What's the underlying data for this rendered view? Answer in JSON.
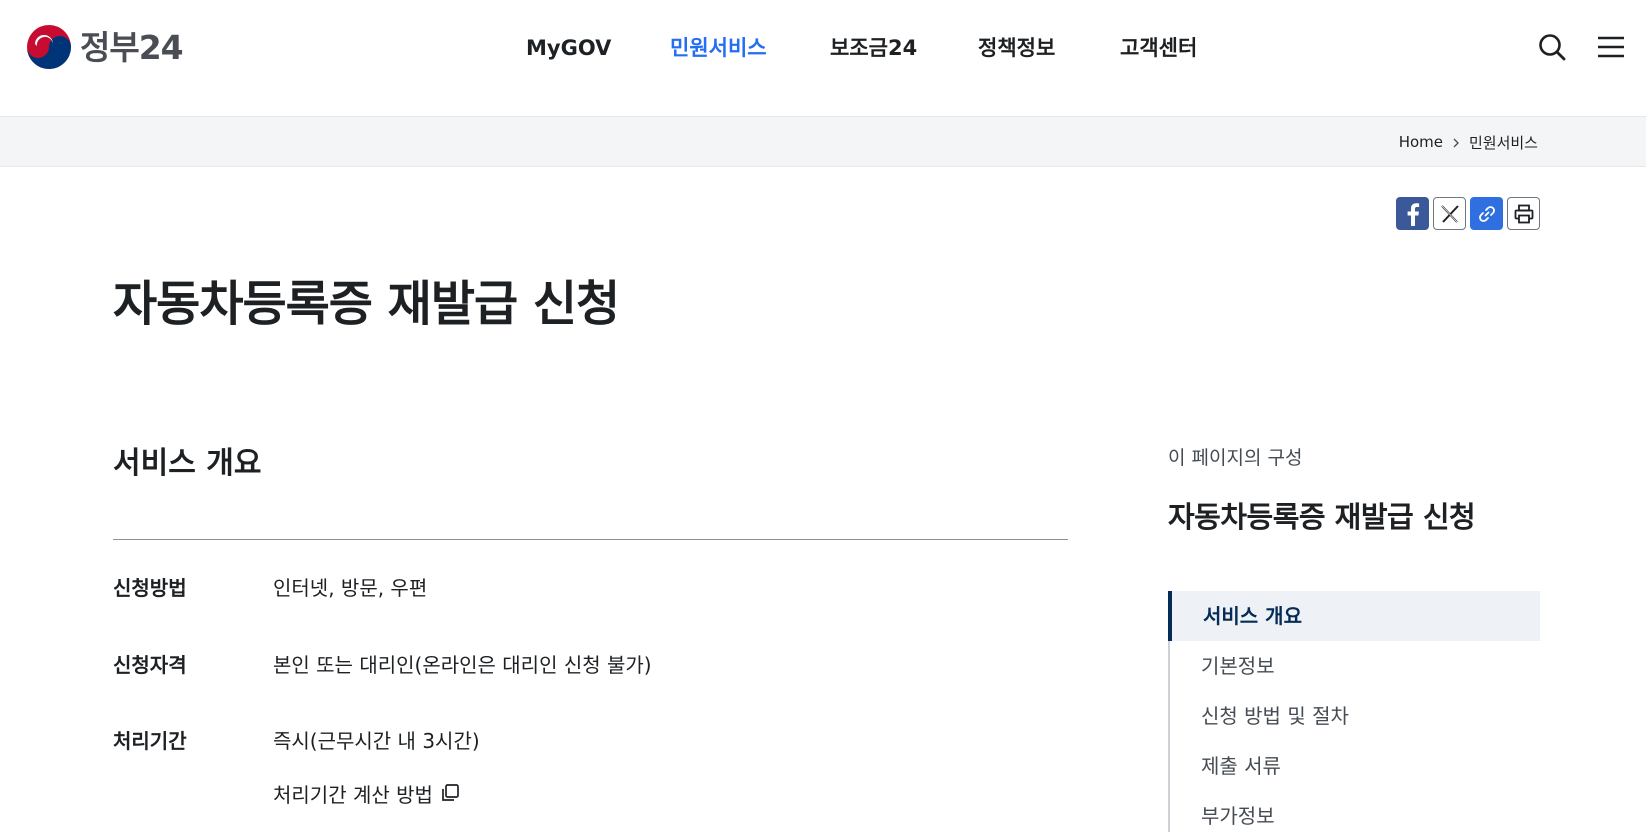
{
  "header": {
    "logo_text": "정부24",
    "nav": [
      "MyGOV",
      "민원서비스",
      "보조금24",
      "정책정보",
      "고객센터"
    ],
    "active_nav": "민원서비스"
  },
  "breadcrumb": {
    "home": "Home",
    "current": "민원서비스"
  },
  "share": [
    "facebook-icon",
    "x-icon",
    "link-icon",
    "print-icon"
  ],
  "page": {
    "title": "자동차등록증 재발급 신청"
  },
  "overview": {
    "title": "서비스 개요",
    "rows": [
      {
        "label": "신청방법",
        "value": "인터넷, 방문, 우편"
      },
      {
        "label": "신청자격",
        "value": "본인 또는 대리인(온라인은 대리인 신청 불가)"
      },
      {
        "label": "처리기간",
        "value": "즉시(근무시간 내 3시간)"
      }
    ],
    "calc_link": "처리기간 계산 방법"
  },
  "toc": {
    "label": "이 페이지의 구성",
    "title": "자동차등록증 재발급 신청",
    "items": [
      "서비스 개요",
      "기본정보",
      "신청 방법 및 절차",
      "제출 서류",
      "부가정보"
    ],
    "active_index": 0
  },
  "colors": {
    "accent": "#256ef4",
    "toc_active": "#052b57",
    "facebook": "#3b5998",
    "link": "#2f6fe0"
  }
}
